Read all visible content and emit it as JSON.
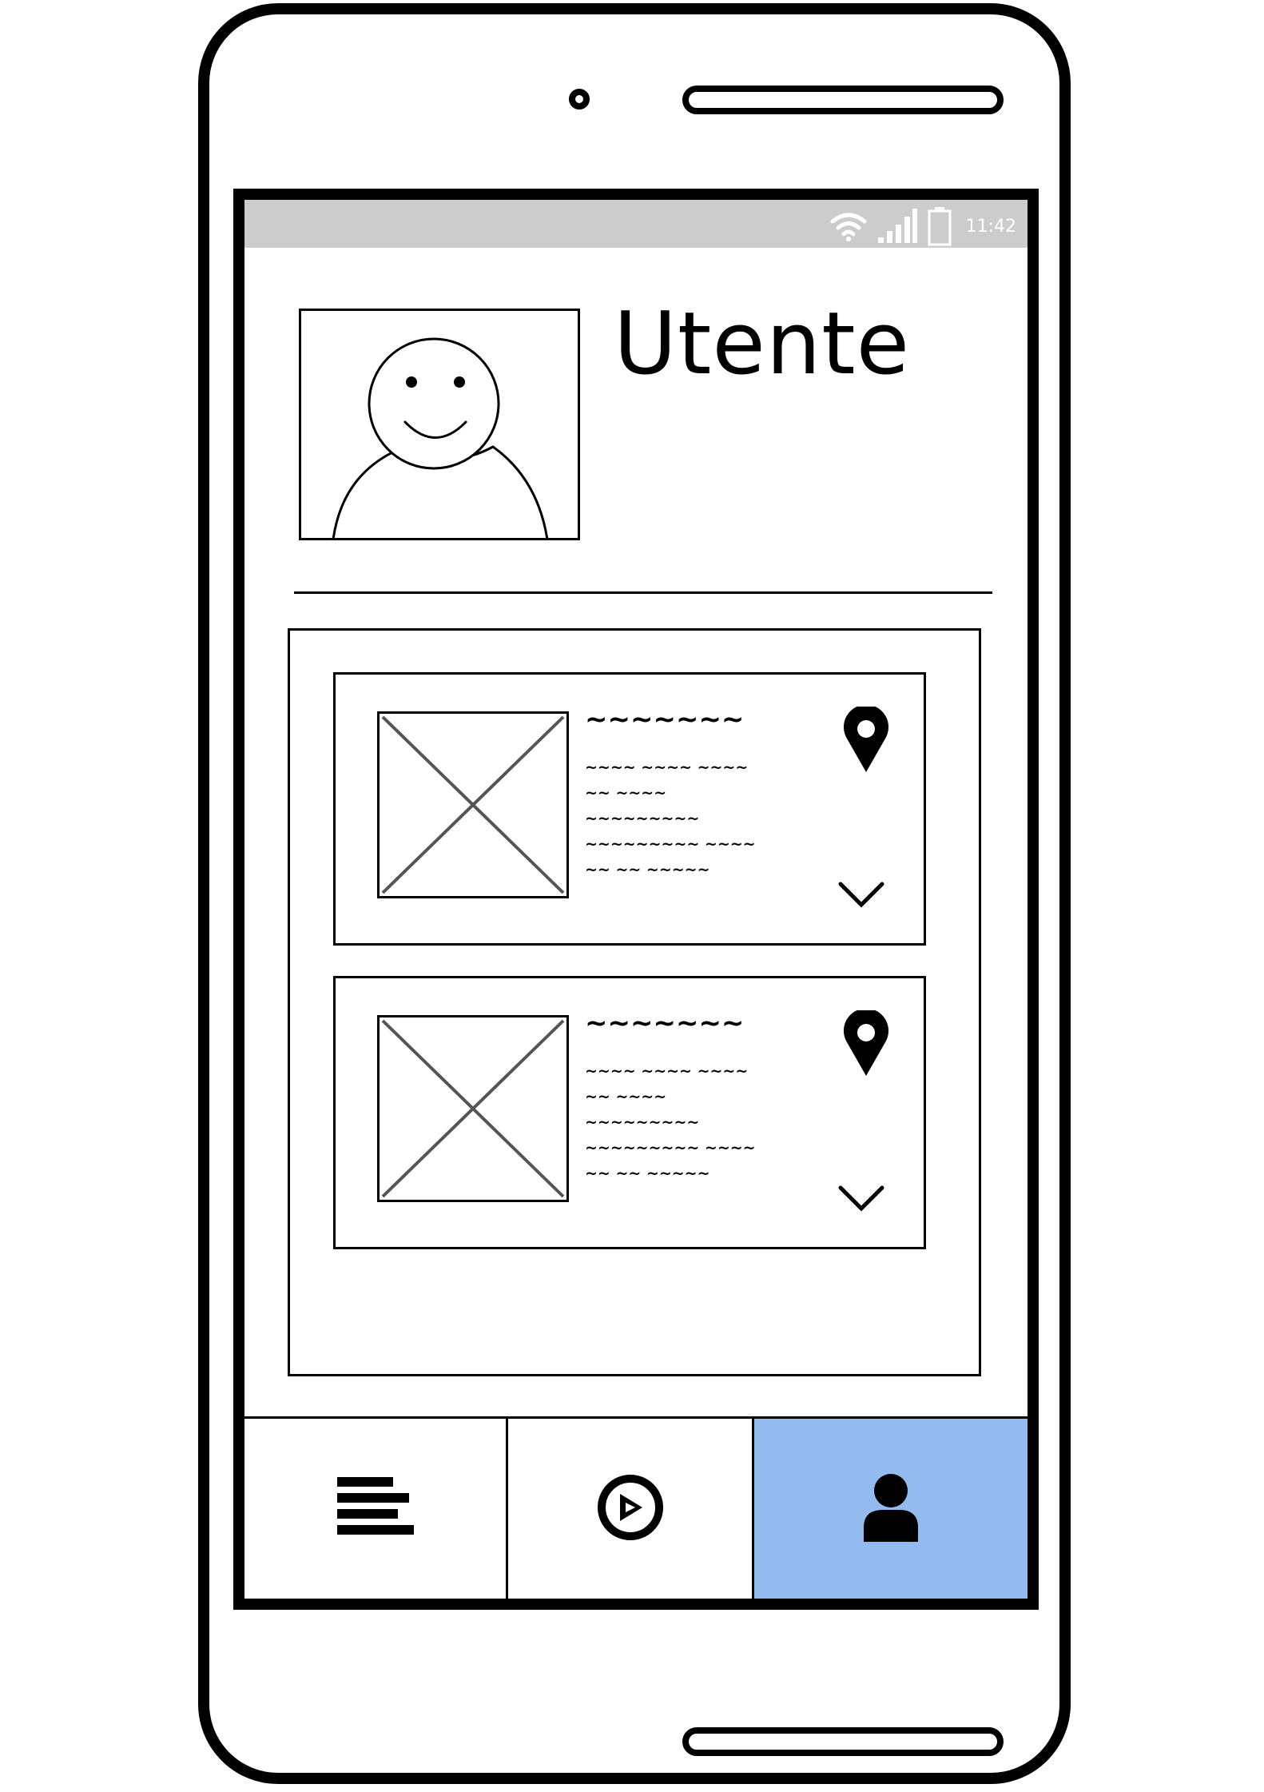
{
  "status_bar": {
    "time": "11:42",
    "icons": [
      "wifi-icon",
      "signal-icon",
      "battery-icon"
    ]
  },
  "profile": {
    "title": "Utente",
    "avatar_icon": "smiley-user-icon"
  },
  "cards": [
    {
      "title": "~~~~~~~",
      "lines": [
        "~~~~ ~~~~ ~~~~",
        "~~ ~~~~",
        "~~~~~~~~~",
        "~~~~~~~~~ ~~~~",
        "~~ ~~ ~~~~~"
      ],
      "icons": [
        "image-placeholder-icon",
        "location-pin-icon",
        "chevron-down-icon"
      ]
    },
    {
      "title": "~~~~~~~",
      "lines": [
        "~~~~ ~~~~ ~~~~",
        "~~ ~~~~",
        "~~~~~~~~~",
        "~~~~~~~~~ ~~~~",
        "~~ ~~ ~~~~~"
      ],
      "icons": [
        "image-placeholder-icon",
        "location-pin-icon",
        "chevron-down-icon"
      ]
    }
  ],
  "bottom_nav": {
    "items": [
      {
        "icon": "list-icon",
        "active": false
      },
      {
        "icon": "compass-icon",
        "active": false
      },
      {
        "icon": "user-icon",
        "active": true
      }
    ],
    "active_color": "#94bbf0"
  },
  "colors": {
    "status_bar": "#cccccc",
    "stroke": "#000000"
  }
}
